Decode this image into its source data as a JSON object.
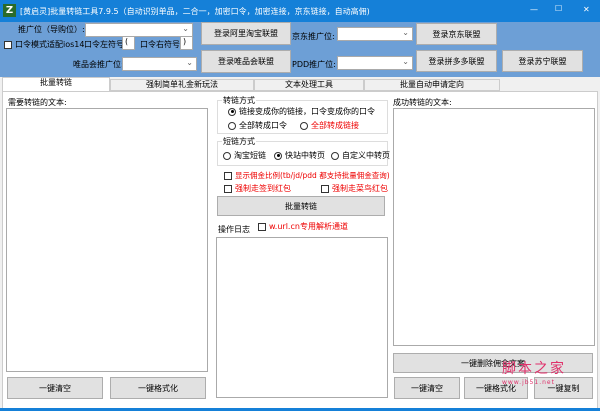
{
  "window": {
    "title": "[黄启灵]批量转链工具7.9.5（自动识别单品，二合一，加密口令，加密连接，京东链接，自动高佣)",
    "icon_letter": "Z",
    "minimize": "—",
    "maximize": "☐",
    "close": "✕"
  },
  "top": {
    "taobao_pid_label": "推广位（导购位）:",
    "taobao_login": "登录阿里淘宝联盟",
    "ios14_label": "口令模式适配ios14",
    "left_symbol_label": "口令左符号",
    "left_symbol_value": "(",
    "right_symbol_label": "口令右符号",
    "right_symbol_value": ")",
    "vip_pid_label": "唯品会推广位:",
    "vip_login": "登录唯品会联盟",
    "jd_pid_label": "京东推广位:",
    "jd_login": "登录京东联盟",
    "pdd_pid_label": "PDD推广位:",
    "pdd_login": "登录拼多多联盟",
    "suning_login": "登录苏宁联盟"
  },
  "tabs": [
    {
      "label": "批量转链"
    },
    {
      "label": "强制简单礼金新玩法"
    },
    {
      "label": "文本处理工具"
    },
    {
      "label": "批量自动申请定向"
    }
  ],
  "left": {
    "label": "需要转链的文本:",
    "clear": "一键清空",
    "format": "一键格式化"
  },
  "middle": {
    "mode_title": "转链方式",
    "mode_opt1": "链接变成你的链接，口令变成你的口令",
    "mode_opt2": "全部转成口令",
    "mode_opt3": "全部转成链接",
    "short_title": "短链方式",
    "short_opt1": "淘宝短链",
    "short_opt2": "快站中转页",
    "short_opt3": "自定义中转页",
    "show_rate": "显示佣金比例(tb/jd/pdd 都支持批量佣金查询)",
    "force_sign": "强制走签到红包",
    "force_cainiao": "强制走菜鸟红包",
    "convert": "批量转链",
    "log_label": "操作日志",
    "wurl": "w.url.cn专用解析通道"
  },
  "right": {
    "label": "成功转链的文本:",
    "delete_commission": "一键删除佣金文案",
    "clear": "一键清空",
    "format": "一键格式化",
    "copy": "一键复制"
  },
  "watermark": {
    "text": "脚本之家",
    "url": "www.jb51.net"
  }
}
